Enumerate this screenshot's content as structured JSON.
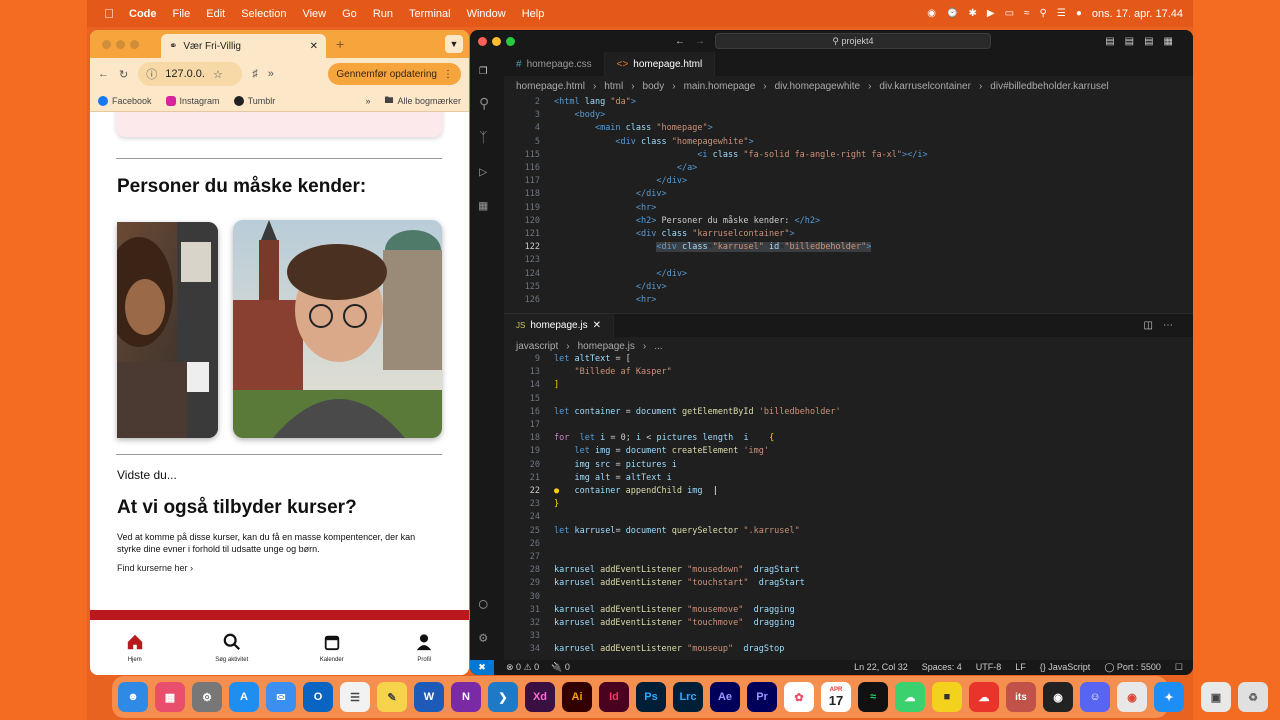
{
  "menubar": {
    "app": "Code",
    "items": [
      "File",
      "Edit",
      "Selection",
      "View",
      "Go",
      "Run",
      "Terminal",
      "Window",
      "Help"
    ],
    "datetime": "ons. 17. apr.  17.44"
  },
  "browser": {
    "tab_title": "Vær Fri-Villig",
    "url": "127.0.0.",
    "update_button": "Gennemfør opdatering",
    "bookmarks": [
      "Facebook",
      "Instagram",
      "Tumblr"
    ],
    "all_bookmarks": "Alle bogmærker",
    "page": {
      "heading1": "Personer du måske kender:",
      "did_you_know": "Vidste du...",
      "heading2": "At vi også tilbyder kurser?",
      "paragraph": "Ved at komme på disse kurser, kan du få en masse kompentencer, der kan styrke dine evner i forhold til udsatte unge og børn.",
      "link": "Find kurserne her"
    },
    "nav": [
      "Hjem",
      "Søg aktivitet",
      "Kalender",
      "Profil"
    ]
  },
  "vscode": {
    "search": "projekt4",
    "top_tabs": [
      "homepage.css",
      "homepage.html"
    ],
    "crumbs_top": [
      "homepage.html",
      "html",
      "body",
      "main.homepage",
      "div.homepagewhite",
      "div.karruselcontainer",
      "div#billedbeholder.karrusel"
    ],
    "bottom_tab": "homepage.js",
    "crumbs_bottom": [
      "javascript",
      "homepage.js",
      "..."
    ],
    "status": {
      "errors": "0",
      "warnings": "0",
      "ports_count": "0",
      "position": "Ln 22, Col 32",
      "spaces": "Spaces: 4",
      "encoding": "UTF-8",
      "eol": "LF",
      "language": "JavaScript",
      "port": "Port : 5500"
    }
  },
  "dock": {
    "calendar_month": "APR",
    "calendar_day": "17"
  }
}
